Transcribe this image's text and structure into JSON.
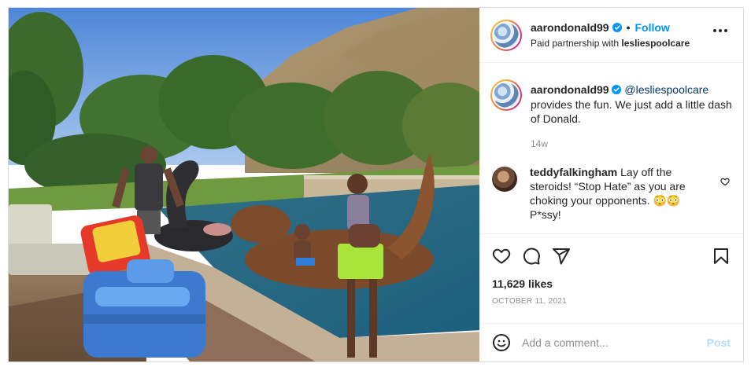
{
  "header": {
    "username": "aarondonald99",
    "dot": "•",
    "follow_label": "Follow",
    "partnership_prefix": "Paid partnership with ",
    "partner": "lesliespoolcare"
  },
  "caption": {
    "username": "aarondonald99",
    "mention": "@lesliespoolcare",
    "text": "provides the fun. We just add a little dash of Donald.",
    "time": "14w"
  },
  "comment": {
    "username": "teddyfalkingham",
    "text": "Lay off the steroids! “Stop Hate” as you are choking your opponents. 😳😳 P*ssy!"
  },
  "stats": {
    "likes": "11,629 likes",
    "date": "OCTOBER 11, 2021"
  },
  "comment_box": {
    "placeholder": "Add a comment...",
    "post_label": "Post"
  },
  "icons": {
    "verified": "verified-badge-icon",
    "more": "more-options-icon",
    "heart": "heart-icon",
    "comment": "comment-icon",
    "share": "share-icon",
    "bookmark": "bookmark-icon",
    "emoji": "emoji-icon"
  },
  "colors": {
    "link_blue": "#0095f6",
    "mention": "#00376b",
    "muted": "#8e8e8e",
    "post_disabled": "#b2dffc",
    "border": "#dbdbdb"
  }
}
